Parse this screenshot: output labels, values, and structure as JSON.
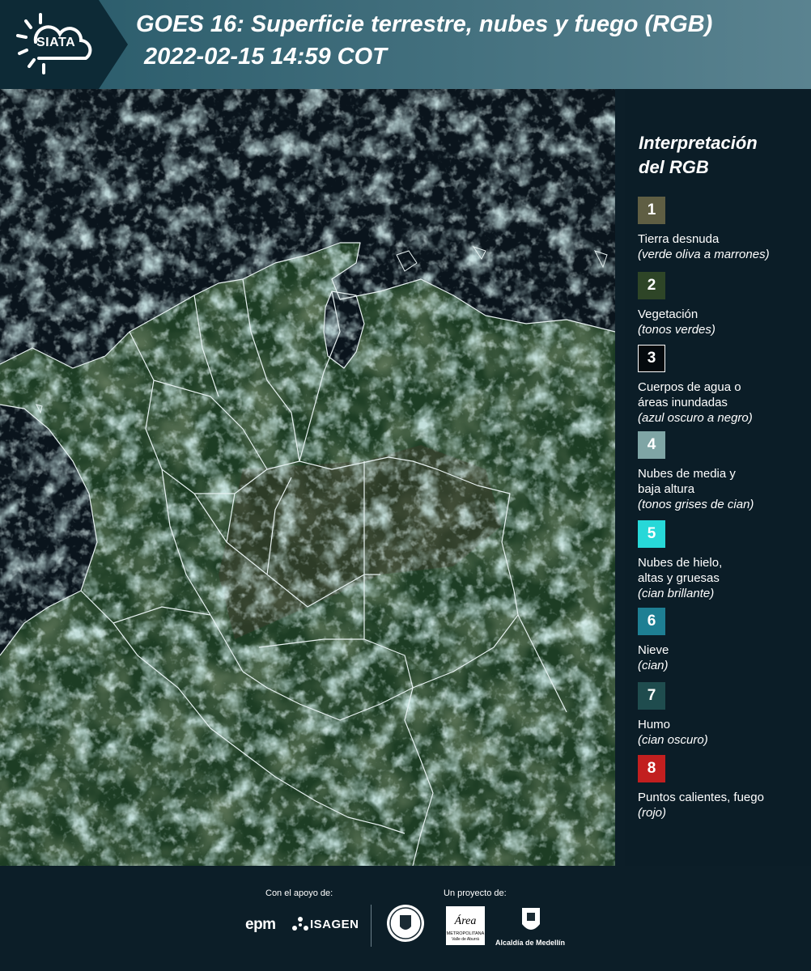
{
  "header": {
    "logo_text": "SIATA",
    "title_line1": "GOES 16: Superficie terrestre, nubes y fuego (RGB)",
    "title_line2": "2022-02-15 14:59 COT"
  },
  "legend": {
    "title_line1": "Interpretación",
    "title_line2": "del RGB",
    "items": [
      {
        "number": "1",
        "label": "Tierra desnuda",
        "note": "(verde oliva a marrones)",
        "color": "#5f5e43"
      },
      {
        "number": "2",
        "label": "Vegetación",
        "note": "(tonos verdes)",
        "color": "#2e4527"
      },
      {
        "number": "3",
        "label": "Cuerpos de agua o áreas inundadas",
        "note": "(azul oscuro a negro)",
        "color": "#050a0e"
      },
      {
        "number": "4",
        "label": "Nubes de media y baja altura",
        "note": "(tonos grises de cian)",
        "color": "#7fa5a5"
      },
      {
        "number": "5",
        "label": "Nubes de hielo, altas y gruesas",
        "note": "(cian brillante)",
        "color": "#27d8d8"
      },
      {
        "number": "6",
        "label": "Nieve",
        "note": "(cian)",
        "color": "#1e7f93"
      },
      {
        "number": "7",
        "label": "Humo",
        "note": "(cian oscuro)",
        "color": "#1f4c4e"
      },
      {
        "number": "8",
        "label": "Puntos calientes, fuego",
        "note": "(rojo)",
        "color": "#c21f1f"
      }
    ]
  },
  "footer": {
    "support_label": "Con el apoyo de:",
    "project_label": "Un proyecto de:",
    "epm": "epm",
    "isagen": "ISAGEN",
    "amva_line1": "Área",
    "amva_line2": "METROPOLITANA",
    "amva_line3": "Valle de Aburrá",
    "alcaldia": "Alcaldía de Medellín"
  }
}
